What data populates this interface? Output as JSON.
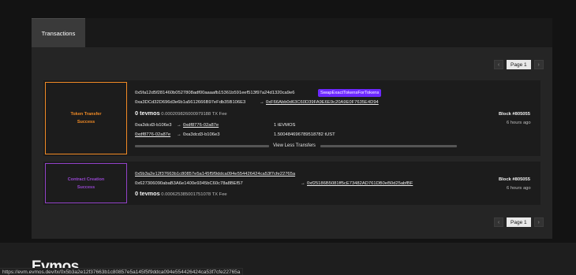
{
  "tabs": [
    {
      "label": "Transactions"
    }
  ],
  "pagination": {
    "top": {
      "label": "Page 1"
    },
    "bottom": {
      "label": "Page 1"
    }
  },
  "transactions": [
    {
      "type": "Token Transfer",
      "status": "Success",
      "hash": "0x5fa12d5f281460b0527808adf00aaaafb15361b591eef513f97a24d1320ca9e6",
      "method_badge": "SwapExactTokensForTokens",
      "from": "0xa3DCd32D696d3e6b1a5612666B97eFdb35B106E3",
      "to": "0xF66Abb0d63C60D39FA9E6E9c20A9E0F7635E4D94",
      "fee_amount": "0 tevmos",
      "fee_detail": "0.000209826000979188 TX Fee",
      "block": "Block #805055",
      "age": "6 hours ago",
      "transfers": [
        {
          "from": "0xa3dcd3-b106e3",
          "to": "0xdf8776-02a87e",
          "amount": "1 tEVMOS"
        },
        {
          "from": "0xdf8776-02a87e",
          "to": "0xa3dcd3-b106e3",
          "amount": "1.500484696789518782 tUST"
        }
      ],
      "toggle_label": "View Less Transfers"
    },
    {
      "type": "Contract Creation",
      "status": "Success",
      "hash": "0x5b3a2e12f37663b1c80857e5a145f5f9ddca094e554426424ca53f7cfe22765a",
      "from": "0x627306090abaB3A6e1400e9345bC60c78a8BEf57",
      "to": "0xf25186B5081ff5cE73482AD761DB0eB0d25abfBF",
      "fee_amount": "0 tevmos",
      "fee_detail": "0.000625385001751078 TX Fee",
      "block": "Block #805055",
      "age": "6 hours ago"
    }
  ],
  "footer": {
    "title": "Evmos"
  },
  "status_url": "https://evm.evmos.dev/tx/0x5b3a2e12f37663b1c80857e5a145f5f9ddca094e554426424ca53f7cfe22765a",
  "icons": {
    "prev": "chevron-left-icon",
    "next": "chevron-right-icon",
    "arrow": "arrow-right-icon"
  },
  "colors": {
    "token_transfer": "#f08a25",
    "contract_creation": "#9242c8",
    "method_badge": "#6d28ff"
  }
}
